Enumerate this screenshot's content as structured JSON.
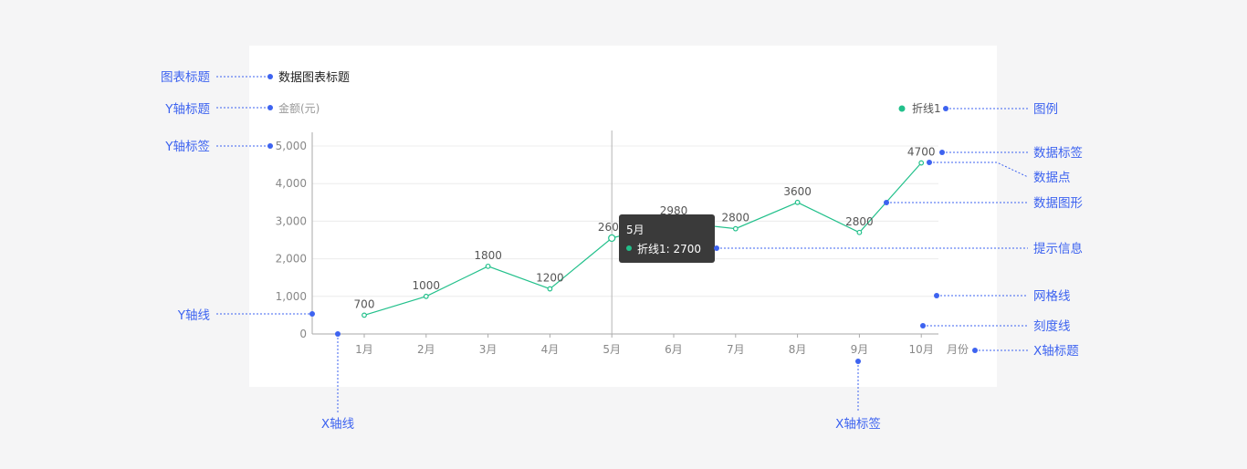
{
  "chart_data": {
    "type": "line",
    "title": "数据图表标题",
    "ylabel": "金额(元)",
    "xlabel": "月份",
    "categories": [
      "1月",
      "2月",
      "3月",
      "4月",
      "5月",
      "6月",
      "7月",
      "8月",
      "9月",
      "10月"
    ],
    "series": [
      {
        "name": "折线1",
        "values": [
          500,
          1000,
          1800,
          1200,
          2550,
          2980,
          2800,
          3500,
          2700,
          4550
        ]
      }
    ],
    "data_labels": [
      "700",
      "1000",
      "1800",
      "1200",
      "2600",
      "2980",
      "2800",
      "3600",
      "2800",
      "4700"
    ],
    "y_ticks": [
      "0",
      "1,000",
      "2,000",
      "3,000",
      "4,000",
      "5,000"
    ],
    "y_tick_values": [
      0,
      1000,
      2000,
      3000,
      4000,
      5000
    ],
    "ylim": [
      0,
      5000
    ],
    "grid": true,
    "legend_position": "top-right",
    "color": "#22c08b",
    "tooltip": {
      "title": "5月",
      "text": "折线1:  2700",
      "category_index": 4
    }
  },
  "annotations": {
    "chart_title": "图表标题",
    "y_axis_title": "Y轴标题",
    "y_axis_label": "Y轴标签",
    "y_axis_line": "Y轴线",
    "x_axis_line": "X轴线",
    "x_axis_label": "X轴标签",
    "legend": "图例",
    "data_label": "数据标签",
    "data_point": "数据点",
    "data_shape": "数据图形",
    "tooltip": "提示信息",
    "grid_line": "网格线",
    "tick_line": "刻度线",
    "x_axis_title": "X轴标题"
  },
  "colors": {
    "annotation": "#3d63f0",
    "series": "#22c08b",
    "tooltip_bg": "#3a3a3a"
  }
}
